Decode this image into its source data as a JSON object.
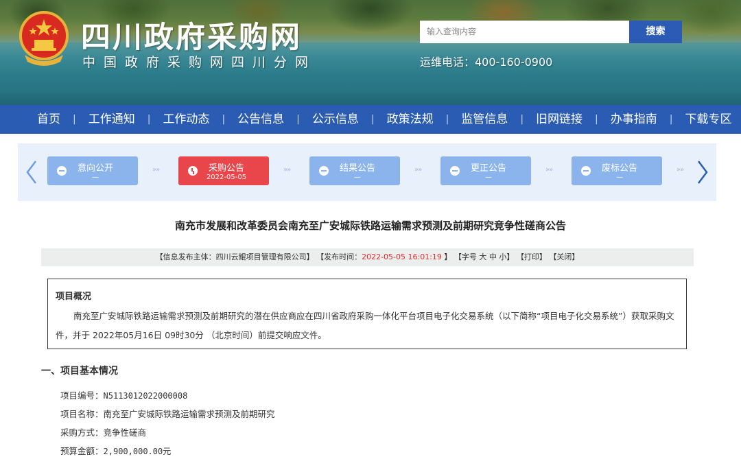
{
  "header": {
    "site_title": "四川政府采购网",
    "site_subtitle": "中国政府采购网四川分网",
    "search_placeholder": "输入查询内容",
    "search_button": "搜索",
    "hotline": "运维电话：400-160-0900"
  },
  "nav": {
    "items": [
      "首页",
      "工作通知",
      "工作动态",
      "公告信息",
      "公示信息",
      "政策法规",
      "监管信息",
      "旧网链接",
      "办事指南",
      "下载专区"
    ]
  },
  "stepper": {
    "steps": [
      {
        "label": "意向公开",
        "date": "—",
        "active": false
      },
      {
        "label": "采购公告",
        "date": "2022-05-05",
        "active": true
      },
      {
        "label": "结果公告",
        "date": "—",
        "active": false
      },
      {
        "label": "更正公告",
        "date": "—",
        "active": false
      },
      {
        "label": "废标公告",
        "date": "—",
        "active": false
      }
    ],
    "dots": "»»"
  },
  "article": {
    "title": "南充市发展和改革委员会南充至广安城际铁路运输需求预测及前期研究竞争性磋商公告",
    "meta_publisher_label": "【信息发布主体：四川云鲲项目管理有限公司】",
    "meta_time_label": "【发布时间：",
    "meta_time_value": "2022-05-05 16:01:19",
    "meta_time_end": "】",
    "meta_font": "【字号 大 中 小】",
    "meta_print": "【打印】",
    "meta_close": "【关闭】",
    "overview_title": "项目概况",
    "overview_text": "南充至广安城际铁路运输需求预测及前期研究的潜在供应商应在四川省政府采购一体化平台项目电子化交易系统（以下简称“项目电子化交易系统”）获取采购文件，并于 2022年05月16日 09时30分 （北京时间）前提交响应文件。",
    "section1_title": "一、项目基本情况",
    "project_no_label": "项目编号：",
    "project_no": "N5113012022000008",
    "project_name_label": "项目名称：",
    "project_name": "南充至广安城际铁路运输需求预测及前期研究",
    "method_label": "采购方式：",
    "method": "竞争性磋商",
    "budget_label": "预算金额：",
    "budget": "2,900,000.00元"
  },
  "colors": {
    "nav_bg": "#2a5cb4",
    "search_btn": "#2c5bb6",
    "step_active": "#e9464b",
    "step_inactive": "#8cb4ec",
    "highlight_red": "#e02a2a"
  }
}
